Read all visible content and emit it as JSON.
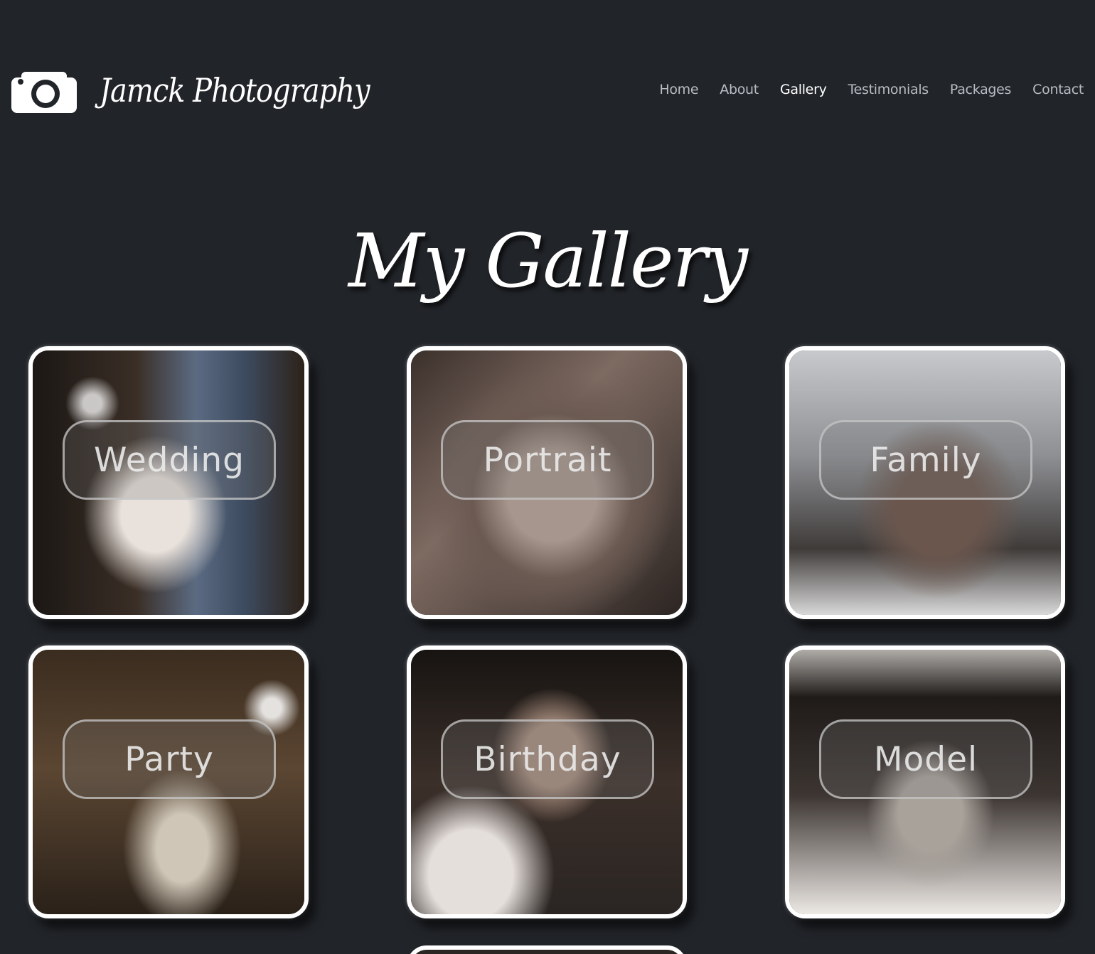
{
  "header": {
    "brand": "Jamck Photography",
    "nav": [
      "Home",
      "About",
      "Gallery",
      "Testimonials",
      "Packages",
      "Contact"
    ],
    "active_nav": "Gallery"
  },
  "gallery": {
    "title": "My Gallery",
    "cards": [
      {
        "label": "Wedding"
      },
      {
        "label": "Portrait"
      },
      {
        "label": "Family"
      },
      {
        "label": "Party"
      },
      {
        "label": "Birthday"
      },
      {
        "label": "Model"
      }
    ]
  },
  "colors": {
    "background": "#212429",
    "text": "#ffffff",
    "nav_text": "#b9bcc2"
  },
  "icons": {
    "logo": "camera-icon"
  }
}
